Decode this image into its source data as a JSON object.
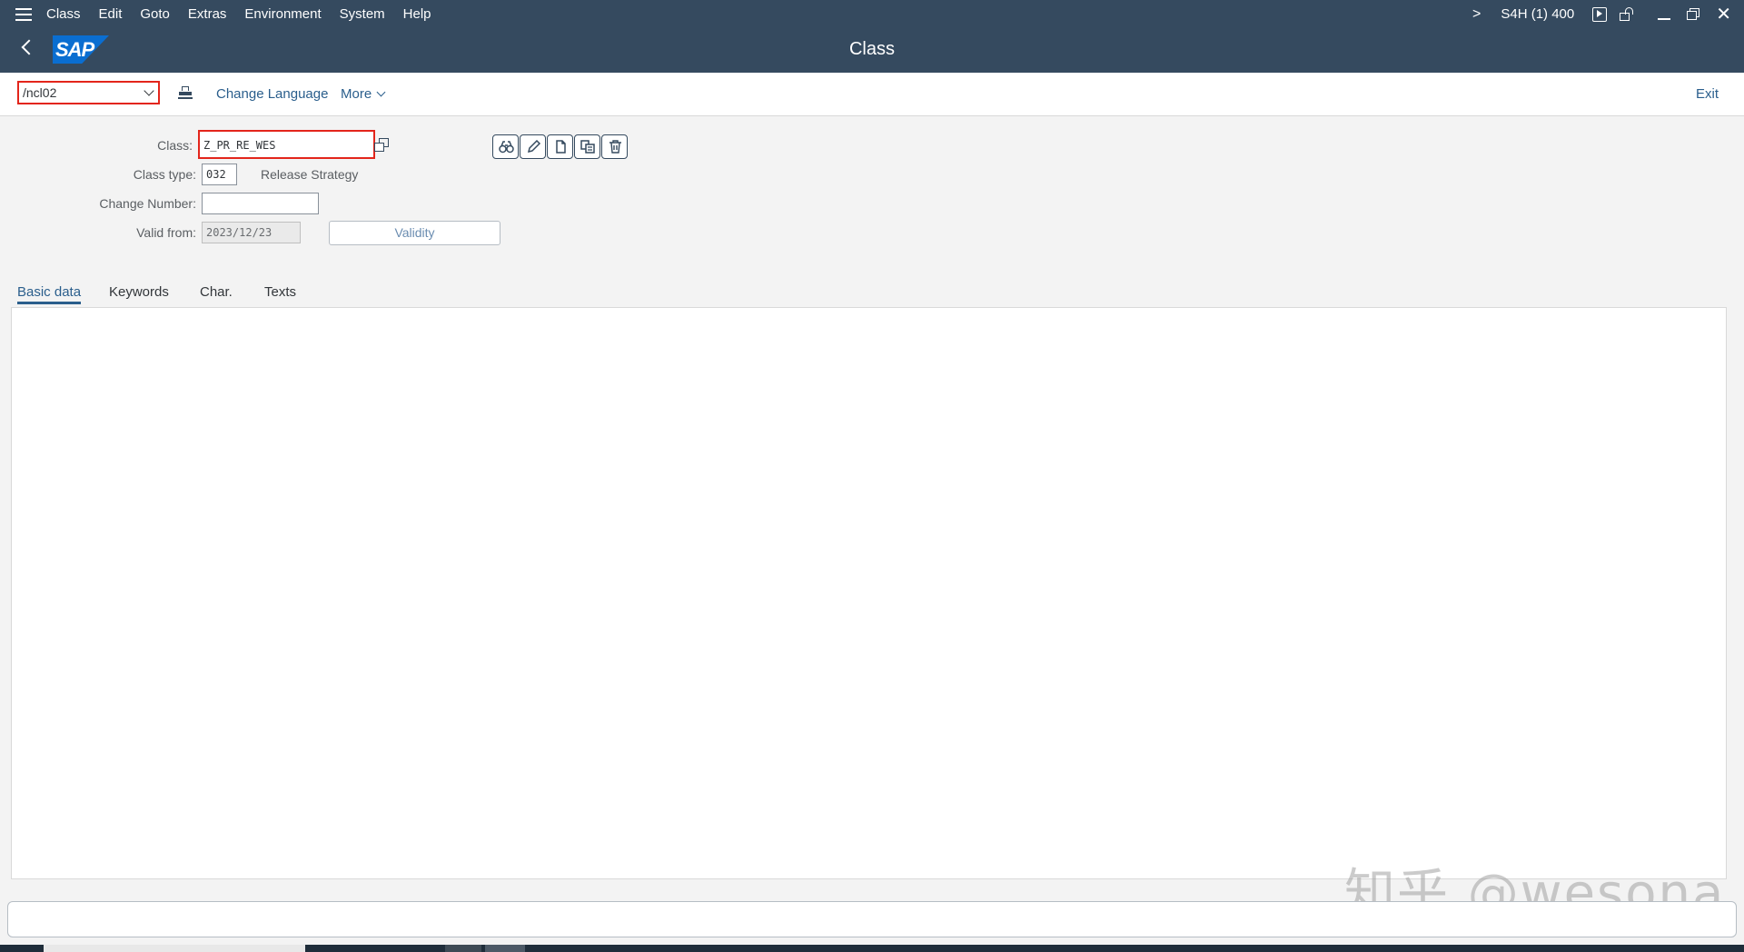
{
  "menubar": {
    "items": [
      "Class",
      "Edit",
      "Goto",
      "Extras",
      "Environment",
      "System",
      "Help"
    ],
    "system_id": "S4H (1) 400",
    "chevron": ">"
  },
  "titlebar": {
    "logo_text": "SAP",
    "title": "Class"
  },
  "toolbar": {
    "command_value": "/ncl02",
    "change_language": "Change Language",
    "more": "More",
    "exit": "Exit"
  },
  "form": {
    "class_label": "Class:",
    "class_value": "Z_PR_RE_WES",
    "class_type_label": "Class type:",
    "class_type_value": "032",
    "class_type_desc": "Release Strategy",
    "change_number_label": "Change Number:",
    "change_number_value": "",
    "valid_from_label": "Valid from:",
    "valid_from_value": "2023/12/23",
    "validity_button": "Validity"
  },
  "action_icons": [
    "display-icon",
    "change-icon",
    "create-icon",
    "copy-icon",
    "delete-icon"
  ],
  "tabs": [
    "Basic data",
    "Keywords",
    "Char.",
    "Texts"
  ],
  "active_tab": "Basic data",
  "watermark": "知乎 @wesona",
  "colors": {
    "shell": "#354a5f",
    "highlight": "#e3251b",
    "link": "#2a5e8c",
    "background": "#f3f3f3"
  }
}
